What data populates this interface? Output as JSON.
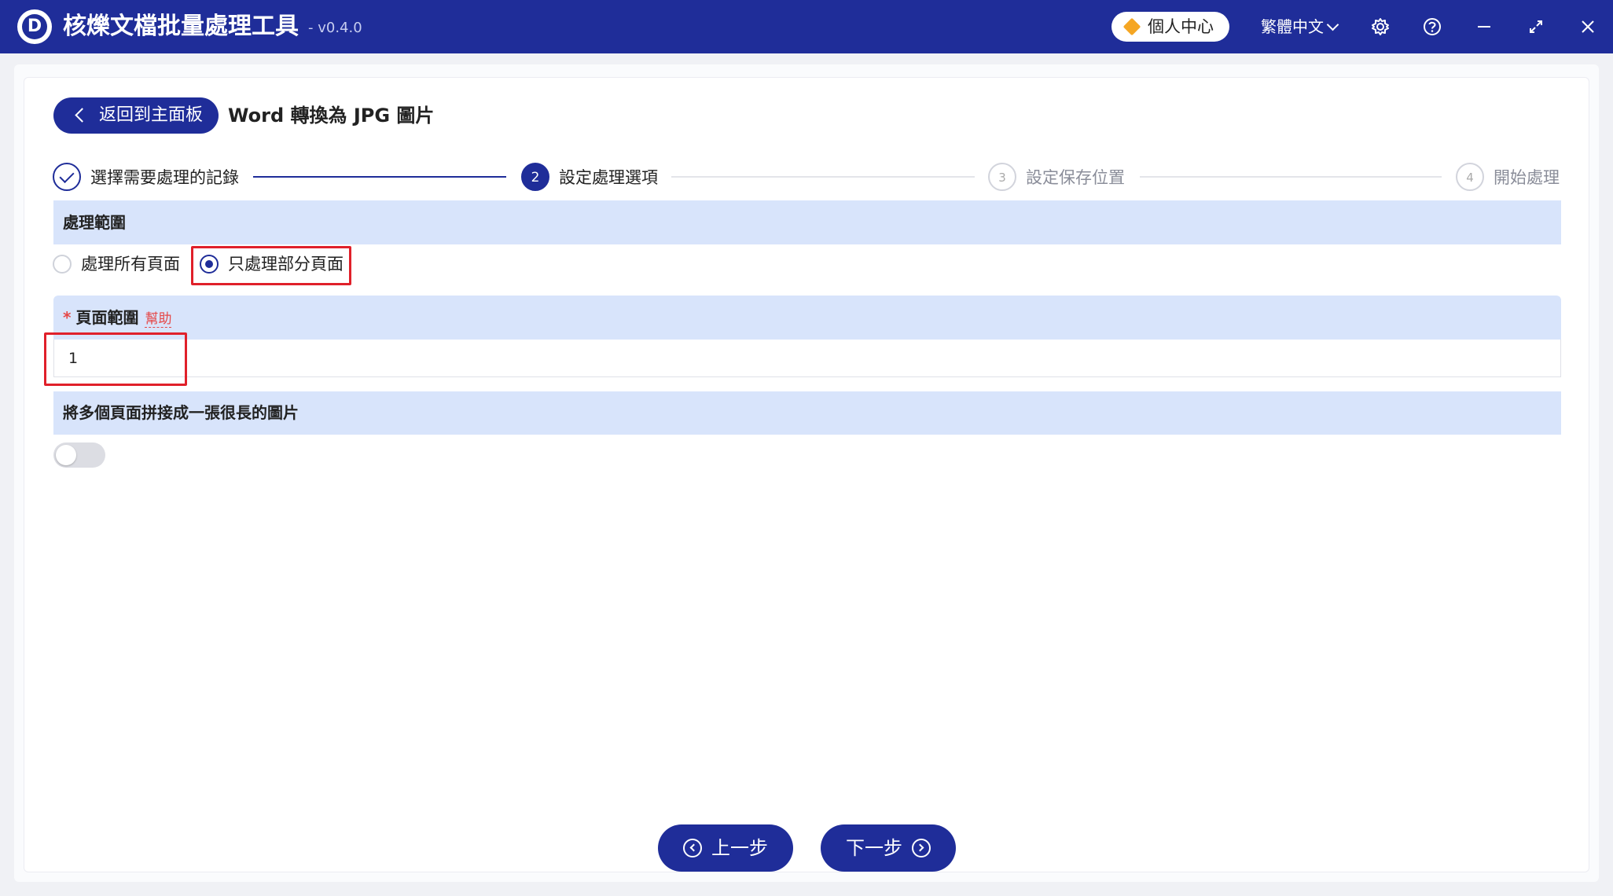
{
  "app": {
    "logo_letter": "D",
    "title": "核爍文檔批量處理工具",
    "version": "- v0.4.0",
    "user_center": "個人中心",
    "language": "繁體中文"
  },
  "header": {
    "back_label": "返回到主面板",
    "page_title": "Word 轉換為 JPG 圖片"
  },
  "steps": [
    {
      "label": "選擇需要處理的記錄",
      "number": "",
      "status": "done"
    },
    {
      "label": "設定處理選項",
      "number": "2",
      "status": "active"
    },
    {
      "label": "設定保存位置",
      "number": "3",
      "status": "pending"
    },
    {
      "label": "開始處理",
      "number": "4",
      "status": "pending"
    }
  ],
  "range_section": {
    "title": "處理範圍",
    "options": [
      {
        "label": "處理所有頁面",
        "checked": false
      },
      {
        "label": "只處理部分頁面",
        "checked": true
      }
    ]
  },
  "page_range": {
    "required_mark": "*",
    "title": "頁面範圍",
    "help": "幫助",
    "value": "1"
  },
  "merge_section": {
    "title": "將多個頁面拼接成一張很長的圖片",
    "enabled": false
  },
  "nav": {
    "prev_label": "上一步",
    "next_label": "下一步"
  },
  "colors": {
    "primary": "#1f2d99",
    "section_bg": "#d8e4fb",
    "highlight": "#e0202a",
    "accent": "#f5a623"
  }
}
